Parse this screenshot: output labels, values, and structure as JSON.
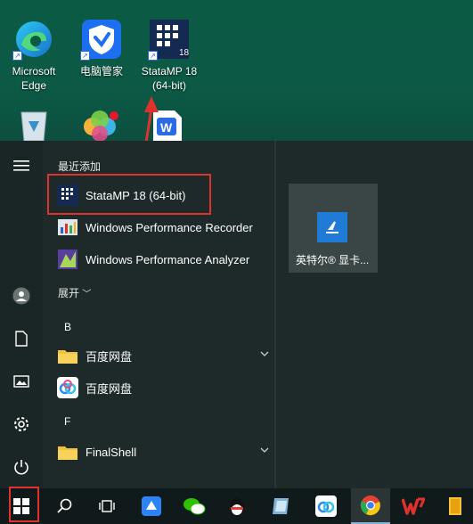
{
  "desktop": {
    "icons": [
      {
        "name": "microsoft-edge",
        "label_line1": "Microsoft",
        "label_line2": "Edge"
      },
      {
        "name": "tencent-pc-manager",
        "label_line1": "电脑管家",
        "label_line2": ""
      },
      {
        "name": "statamp",
        "label_line1": "StataMP 18",
        "label_line2": "(64-bit)"
      }
    ]
  },
  "start_menu": {
    "recent_header": "最近添加",
    "recent_items": [
      {
        "label": "StataMP 18 (64-bit)"
      },
      {
        "label": "Windows Performance Recorder"
      },
      {
        "label": "Windows Performance Analyzer"
      }
    ],
    "expand_label": "展开",
    "groups": [
      {
        "letter": "B",
        "items": [
          {
            "label": "百度网盘"
          },
          {
            "label": "百度网盘"
          }
        ]
      },
      {
        "letter": "F",
        "items": [
          {
            "label": "FinalShell"
          }
        ]
      }
    ],
    "tile": {
      "label": "英特尔® 显卡..."
    }
  },
  "colors": {
    "accent": "#e0322d",
    "start_bg": "#1e2a2a",
    "taskbar_bg": "#111a1b"
  }
}
